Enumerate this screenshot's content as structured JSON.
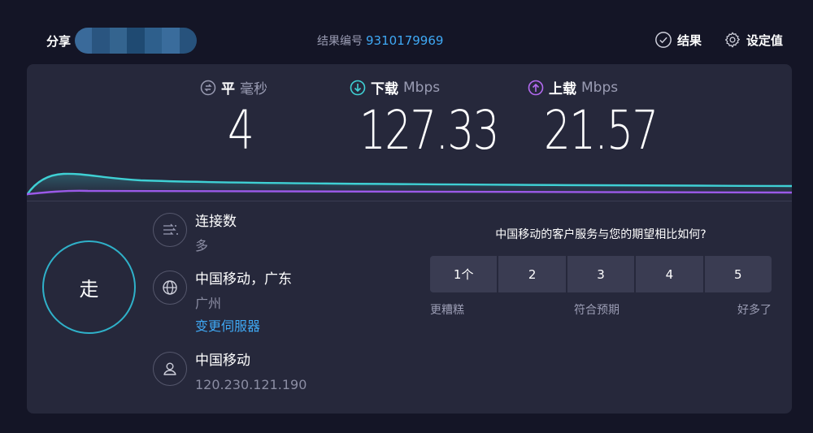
{
  "header": {
    "share_label": "分享",
    "result_id_label": "结果编号",
    "result_id": "9310179969",
    "results_label": "结果",
    "settings_label": "设定值"
  },
  "metrics": {
    "ping": {
      "label": "平",
      "unit": "毫秒",
      "value": "4"
    },
    "download": {
      "label": "下载",
      "unit": "Mbps",
      "value": "127.33"
    },
    "upload": {
      "label": "上载",
      "unit": "Mbps",
      "value": "21.57"
    }
  },
  "go_button": {
    "label": "走"
  },
  "connections": {
    "title": "连接数",
    "value": "多"
  },
  "server": {
    "title": "中国移动，广东",
    "location": "广州",
    "change_label": "变更伺服器"
  },
  "provider": {
    "name": "中国移动",
    "ip": "120.230.121.190"
  },
  "survey": {
    "question": "中国移动的客户服务与您的期望相比如何?",
    "options": [
      "1个",
      "2",
      "3",
      "4",
      "5"
    ],
    "scale_low": "更糟糕",
    "scale_mid": "符合预期",
    "scale_high": "好多了"
  },
  "colors": {
    "background": "#141526",
    "panel": "#26283b",
    "download_line": "#3fd0d4",
    "upload_line": "#9b59e8",
    "accent_link": "#3fa9f5",
    "go_ring": "#2fb1c9"
  },
  "icons": {
    "ping": "ping-icon",
    "download": "download-arrow-icon",
    "upload": "upload-arrow-icon",
    "results": "check-circle-icon",
    "settings": "gear-icon",
    "connections": "connections-icon",
    "server": "globe-icon",
    "provider": "person-icon"
  }
}
